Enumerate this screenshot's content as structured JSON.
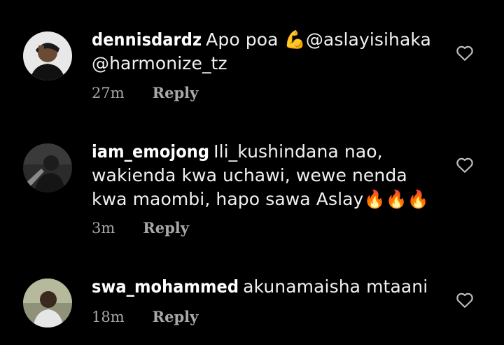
{
  "comments": [
    {
      "username": "dennisdardz",
      "text": "Apo poa 💪@aslayisihaka @harmonize_tz",
      "time": "27m",
      "reply": "Reply"
    },
    {
      "username": "iam_emojong",
      "text": "Ili_kushindana nao, wakienda kwa uchawi, wewe nenda kwa maombi, hapo sawa Aslay🔥🔥🔥",
      "time": "3m",
      "reply": "Reply"
    },
    {
      "username": "swa_mohammed",
      "text": "akunamaisha mtaani",
      "time": "18m",
      "reply": "Reply"
    }
  ],
  "colors": {
    "background": "#000000",
    "text": "#f0f0f0",
    "meta": "#a8a8a8"
  },
  "icons": {
    "like": "heart-outline-icon"
  }
}
